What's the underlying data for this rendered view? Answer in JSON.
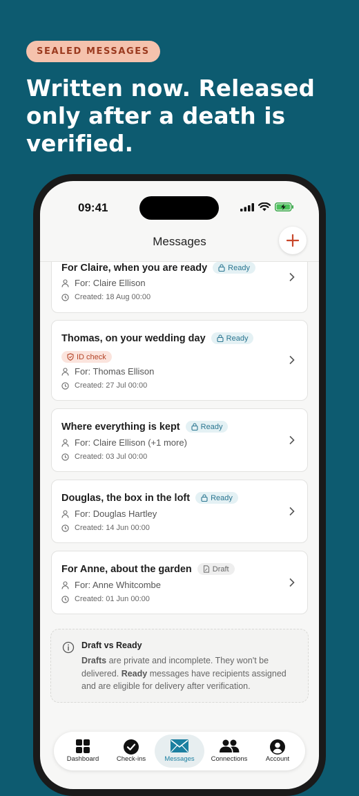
{
  "hero": {
    "badge": "SEALED MESSAGES",
    "headline": "Written now. Released only after a death is verified."
  },
  "status_bar": {
    "time": "09:41"
  },
  "nav": {
    "title": "Messages",
    "add_icon": "plus-icon"
  },
  "messages": [
    {
      "title": "For Claire, when you are ready",
      "status": "Ready",
      "for": "For: Claire Ellison",
      "created": "Created: 18 Aug 00:00"
    },
    {
      "title": "Thomas, on your wedding day",
      "status": "Ready",
      "flag": "ID check",
      "for": "For: Thomas Ellison",
      "created": "Created: 27 Jul 00:00"
    },
    {
      "title": "Where everything is kept",
      "status": "Ready",
      "for": "For: Claire Ellison (+1 more)",
      "created": "Created: 03 Jul 00:00"
    },
    {
      "title": "Douglas, the box in the loft",
      "status": "Ready",
      "for": "For: Douglas Hartley",
      "created": "Created: 14 Jun 00:00"
    },
    {
      "title": "For Anne, about the garden",
      "status": "Draft",
      "for": "For: Anne Whitcombe",
      "created": "Created: 01 Jun 00:00"
    }
  ],
  "info": {
    "title": "Draft vs Ready",
    "drafts_word": "Drafts",
    "body_1": " are private and incomplete. They won't be delivered. ",
    "ready_word": "Ready",
    "body_2": " messages have recipients assigned and are eligible for delivery after verification."
  },
  "tabs": [
    {
      "label": "Dashboard",
      "icon": "dashboard-icon"
    },
    {
      "label": "Check-ins",
      "icon": "checkmark-icon"
    },
    {
      "label": "Messages",
      "icon": "envelope-icon",
      "active": true
    },
    {
      "label": "Connections",
      "icon": "people-icon"
    },
    {
      "label": "Account",
      "icon": "account-icon"
    }
  ],
  "colors": {
    "background": "#0d5b70",
    "badge_bg": "#f5c2ad",
    "accent": "#c8462a",
    "ready": "#2a7590",
    "active_tab": "#1b7fa0"
  }
}
